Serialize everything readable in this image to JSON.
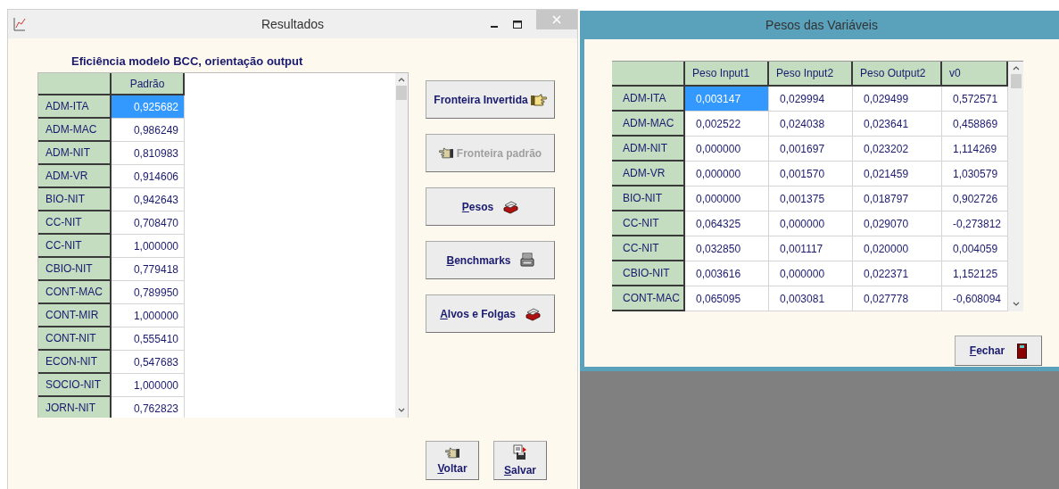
{
  "results_window": {
    "title": "Resultados",
    "heading": "Eficiência modelo BCC, orientação output",
    "table": {
      "column": "Padrão",
      "rows": [
        {
          "name": "ADM-ITA",
          "value": "0,925682",
          "selected": true
        },
        {
          "name": "ADM-MAC",
          "value": "0,986249",
          "selected": false
        },
        {
          "name": "ADM-NIT",
          "value": "0,810983",
          "selected": false
        },
        {
          "name": "ADM-VR",
          "value": "0,914606",
          "selected": false
        },
        {
          "name": "BIO-NIT",
          "value": "0,942643",
          "selected": false
        },
        {
          "name": "CC-NIT",
          "value": "0,708470",
          "selected": false
        },
        {
          "name": "CC-NIT",
          "value": "1,000000",
          "selected": false
        },
        {
          "name": "CBIO-NIT",
          "value": "0,779418",
          "selected": false
        },
        {
          "name": "CONT-MAC",
          "value": "0,789950",
          "selected": false
        },
        {
          "name": "CONT-MIR",
          "value": "1,000000",
          "selected": false
        },
        {
          "name": "CONT-NIT",
          "value": "0,555410",
          "selected": false
        },
        {
          "name": "ECON-NIT",
          "value": "0,547683",
          "selected": false
        },
        {
          "name": "SOCIO-NIT",
          "value": "1,000000",
          "selected": false
        },
        {
          "name": "JORN-NIT",
          "value": "0,762823",
          "selected": false
        }
      ]
    },
    "buttons": [
      {
        "label": "Fronteira Invertida",
        "kind": "hand-right",
        "disabled": false,
        "mnemonic": false
      },
      {
        "label": "Fronteira padrão",
        "kind": "hand-left",
        "disabled": true,
        "mnemonic": false
      },
      {
        "label": "Pesos",
        "kind": "stack",
        "disabled": false,
        "mnemonic": true
      },
      {
        "label": "Benchmarks",
        "kind": "printer",
        "disabled": false,
        "mnemonic": true
      },
      {
        "label": "Alvos e Folgas",
        "kind": "stack",
        "disabled": false,
        "mnemonic": true
      }
    ],
    "bottom_buttons": [
      {
        "label": "Voltar",
        "kind": "hand-left",
        "mnemonic": true
      },
      {
        "label": "Salvar",
        "kind": "save",
        "mnemonic": true
      }
    ]
  },
  "weights_window": {
    "title": "Pesos das Variáveis",
    "table": {
      "columns": [
        "Peso Input1",
        "Peso Input2",
        "Peso Output2",
        "v0"
      ],
      "rows": [
        {
          "name": "ADM-ITA",
          "cells": [
            {
              "text": "0,003147",
              "selected": true
            },
            {
              "text": "0,029994",
              "selected": false
            },
            {
              "text": "0,029499",
              "selected": false
            },
            {
              "text": "0,572571",
              "selected": false
            }
          ]
        },
        {
          "name": "ADM-MAC",
          "cells": [
            {
              "text": "0,002522",
              "selected": false
            },
            {
              "text": "0,024038",
              "selected": false
            },
            {
              "text": "0,023641",
              "selected": false
            },
            {
              "text": "0,458869",
              "selected": false
            }
          ]
        },
        {
          "name": "ADM-NIT",
          "cells": [
            {
              "text": "0,000000",
              "selected": false
            },
            {
              "text": "0,001697",
              "selected": false
            },
            {
              "text": "0,023202",
              "selected": false
            },
            {
              "text": "1,114269",
              "selected": false
            }
          ]
        },
        {
          "name": "ADM-VR",
          "cells": [
            {
              "text": "0,000000",
              "selected": false
            },
            {
              "text": "0,001570",
              "selected": false
            },
            {
              "text": "0,021459",
              "selected": false
            },
            {
              "text": "1,030579",
              "selected": false
            }
          ]
        },
        {
          "name": "BIO-NIT",
          "cells": [
            {
              "text": "0,000000",
              "selected": false
            },
            {
              "text": "0,001375",
              "selected": false
            },
            {
              "text": "0,018797",
              "selected": false
            },
            {
              "text": "0,902726",
              "selected": false
            }
          ]
        },
        {
          "name": "CC-NIT",
          "cells": [
            {
              "text": "0,064325",
              "selected": false
            },
            {
              "text": "0,000000",
              "selected": false
            },
            {
              "text": "0,029070",
              "selected": false
            },
            {
              "text": "-0,273812",
              "selected": false
            }
          ]
        },
        {
          "name": "CC-NIT",
          "cells": [
            {
              "text": "0,032850",
              "selected": false
            },
            {
              "text": "0,001117",
              "selected": false
            },
            {
              "text": "0,020000",
              "selected": false
            },
            {
              "text": "0,004059",
              "selected": false
            }
          ]
        },
        {
          "name": "CBIO-NIT",
          "cells": [
            {
              "text": "0,003616",
              "selected": false
            },
            {
              "text": "0,000000",
              "selected": false
            },
            {
              "text": "0,022371",
              "selected": false
            },
            {
              "text": "1,152125",
              "selected": false
            }
          ]
        },
        {
          "name": "CONT-MAC",
          "cells": [
            {
              "text": "0,065095",
              "selected": false
            },
            {
              "text": "0,003081",
              "selected": false
            },
            {
              "text": "0,027778",
              "selected": false
            },
            {
              "text": "-0,608094",
              "selected": false
            }
          ]
        }
      ]
    },
    "close_button": {
      "label": "Fechar",
      "mnemonic": true
    }
  }
}
